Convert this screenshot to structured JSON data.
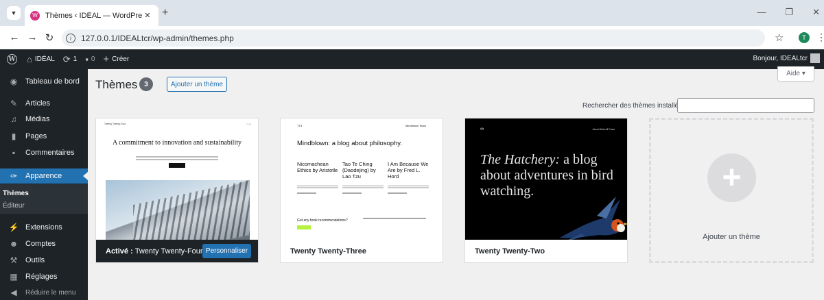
{
  "browser": {
    "tab_title": "Thèmes ‹ IDÉAL — WordPress",
    "url": "127.0.0.1/IDEALtcr/wp-admin/themes.php",
    "profile_initial": "T"
  },
  "adminbar": {
    "site_name": "IDÉAL",
    "updates_count": "1",
    "comments_count": "0",
    "new_label": "Créer",
    "greeting": "Bonjour, IDEALtcr"
  },
  "sidebar": {
    "items": [
      {
        "label": "Tableau de bord",
        "icon": "dashboard-icon"
      },
      {
        "label": "Articles",
        "icon": "pin-icon"
      },
      {
        "label": "Médias",
        "icon": "media-icon"
      },
      {
        "label": "Pages",
        "icon": "pages-icon"
      },
      {
        "label": "Commentaires",
        "icon": "comments-icon"
      },
      {
        "label": "Apparence",
        "icon": "appearance-icon"
      },
      {
        "label": "Extensions",
        "icon": "plugins-icon"
      },
      {
        "label": "Comptes",
        "icon": "users-icon"
      },
      {
        "label": "Outils",
        "icon": "tools-icon"
      },
      {
        "label": "Réglages",
        "icon": "settings-icon"
      },
      {
        "label": "Réduire le menu",
        "icon": "collapse-icon"
      }
    ],
    "submenu": [
      "Thèmes",
      "Éditeur"
    ]
  },
  "main": {
    "title": "Thèmes",
    "count": "3",
    "add_button": "Ajouter un thème",
    "help_button": "Aide ▾",
    "search_label": "Rechercher des thèmes installés",
    "search_value": ""
  },
  "themes": [
    {
      "active_prefix": "Activé :",
      "name": "Twenty Twenty-Four",
      "customize_label": "Personnaliser",
      "preview": {
        "site": "Twenty Twenty-Four",
        "headline": "A commitment to innovation and sustainability"
      }
    },
    {
      "name": "Twenty Twenty-Three",
      "preview": {
        "logo": "TT3",
        "nav": "Mindblown   Team",
        "headline": "Mindblown: a blog about philosophy.",
        "posts": [
          "Nicomachean Ethics by Aristotle",
          "Tao Te Ching (Daodejing) by Lao Tzu",
          "I Am Because We Are by Fred L. Hord"
        ],
        "cta": "Got any book recommendations?"
      }
    },
    {
      "name": "Twenty Twenty-Two",
      "preview": {
        "logo": "∞",
        "nav": "About   Birds   All Posts",
        "headline_italic": "The Hatchery:",
        "headline_rest": " a blog about adventures in bird watching."
      }
    }
  ],
  "add_card_label": "Ajouter un thème",
  "colors": {
    "admin_dark": "#1d2327",
    "accent_blue": "#2271b1",
    "background": "#f0f0f1"
  }
}
